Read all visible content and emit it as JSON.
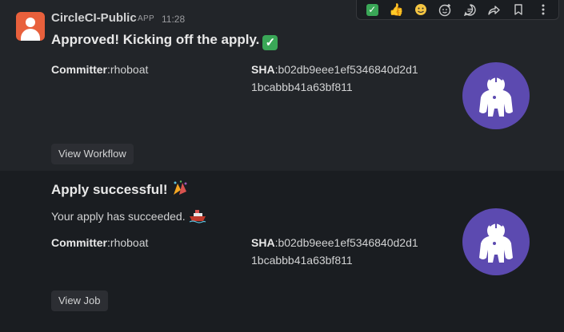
{
  "messages": [
    {
      "sender": "CircleCI-Public",
      "badge": "APP",
      "time": "11:28",
      "title": "Approved! Kicking off the apply.",
      "title_emoji": "✅",
      "committer_label": "Committer",
      "committer_value": ":rhoboat",
      "sha_label": "SHA",
      "sha_value": ":b02db9eee1ef5346840d2d1 1bcabbb41a63bf811",
      "button": "View Workflow"
    },
    {
      "title": "Apply successful!",
      "title_emoji": "🎊",
      "description": "Your apply has succeeded.",
      "description_emoji": "🚢",
      "committer_label": "Committer",
      "committer_value": ":rhoboat",
      "sha_label": "SHA",
      "sha_value": ":b02db9eee1ef5346840d2d1 1bcabbb41a63bf811",
      "button": "View Job"
    }
  ],
  "toolbar": {
    "items": [
      "check-emoji-reaction",
      "thumbs-up-reaction",
      "smile-reaction",
      "add-reaction-icon",
      "reply-in-thread-icon",
      "share-icon",
      "bookmark-icon",
      "more-actions-icon"
    ]
  },
  "colors": {
    "avatar": "#e8603c",
    "robot_bg": "#5c4ab0",
    "check_green": "#3aa757",
    "msg_highlight": "#222529",
    "background": "#1a1d21"
  }
}
